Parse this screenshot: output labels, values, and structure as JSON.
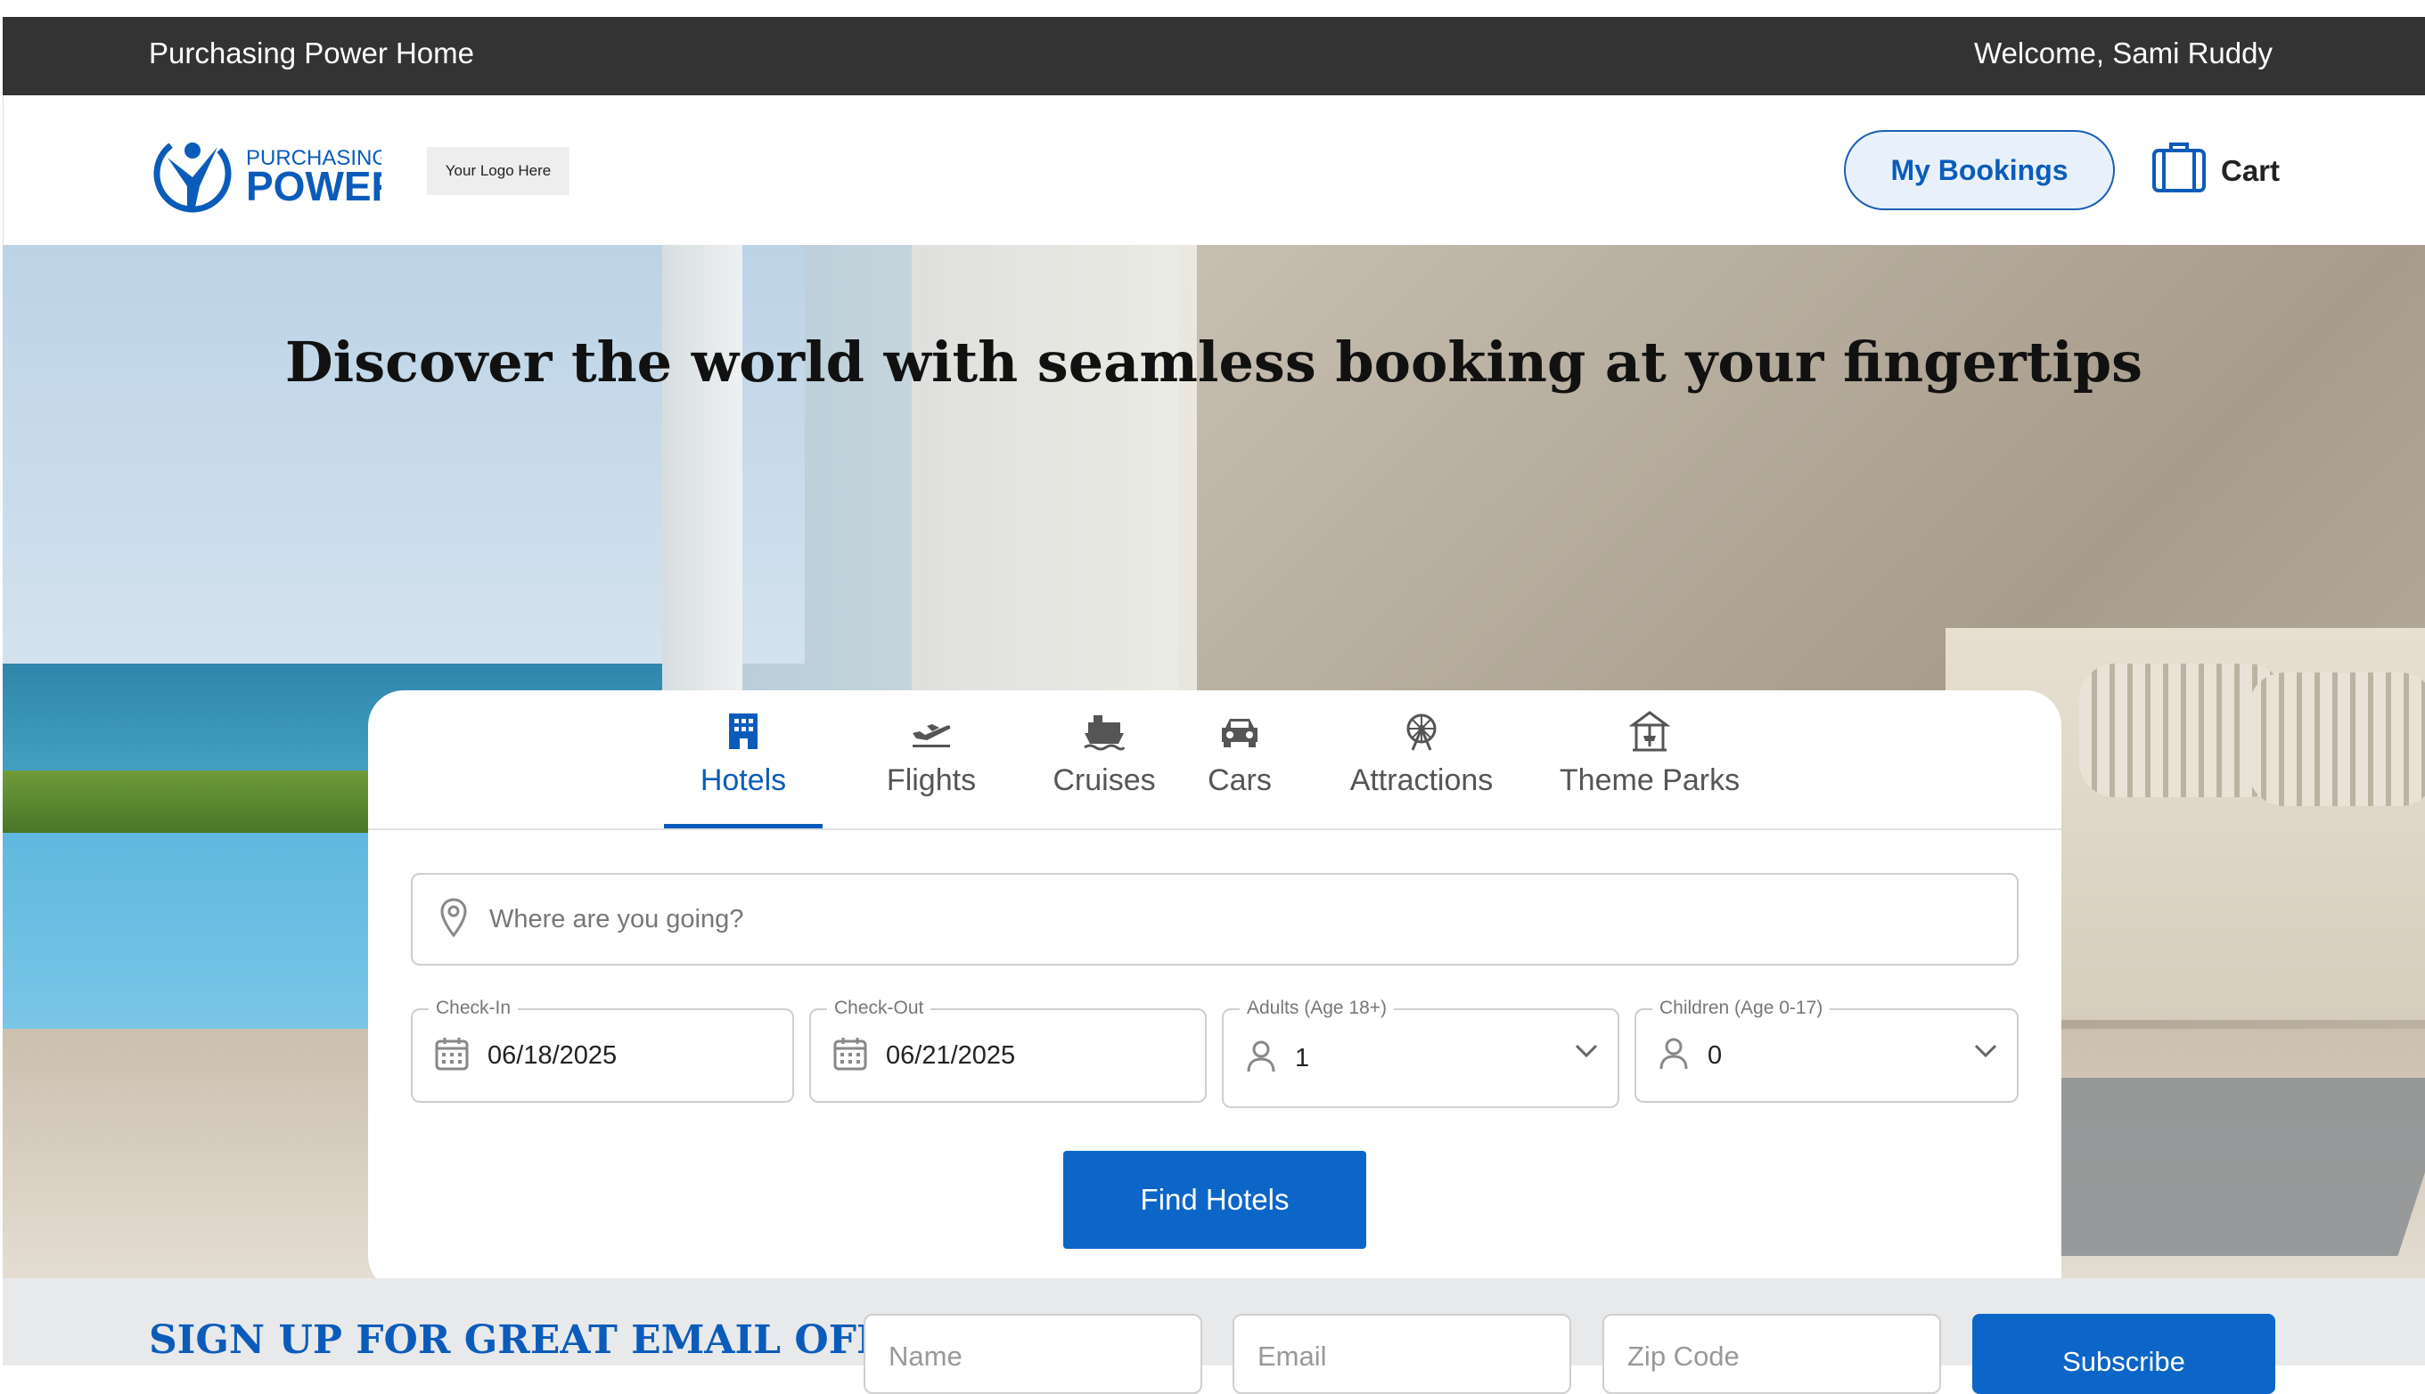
{
  "topbar": {
    "home_link": "Purchasing Power Home",
    "welcome": "Welcome, Sami Ruddy"
  },
  "header": {
    "brand_top": "PURCHASING",
    "brand_bottom": "POWER",
    "logo_placeholder": "Your Logo Here",
    "my_bookings": "My Bookings",
    "cart": "Cart"
  },
  "hero": {
    "title": "Discover the world with seamless booking at your fingertips"
  },
  "tabs": [
    {
      "label": "Hotels",
      "icon": "hotel-icon",
      "active": true
    },
    {
      "label": "Flights",
      "icon": "flight-icon",
      "active": false
    },
    {
      "label": "Cruises",
      "icon": "cruise-ship-icon",
      "active": false
    },
    {
      "label": "Cars",
      "icon": "car-icon",
      "active": false
    },
    {
      "label": "Attractions",
      "icon": "ferris-wheel-icon",
      "active": false
    },
    {
      "label": "Theme Parks",
      "icon": "carousel-icon",
      "active": false
    }
  ],
  "search": {
    "destination_placeholder": "Where are you going?",
    "checkin_label": "Check-In",
    "checkin_value": "06/18/2025",
    "checkout_label": "Check-Out",
    "checkout_value": "06/21/2025",
    "adults_label": "Adults (Age 18+)",
    "adults_value": "1",
    "children_label": "Children (Age 0-17)",
    "children_value": "0",
    "find_button": "Find Hotels"
  },
  "signup": {
    "title": "SIGN UP FOR GREAT EMAIL OFFERS",
    "name_placeholder": "Name",
    "email_placeholder": "Email",
    "zip_placeholder": "Zip Code",
    "subscribe": "Subscribe"
  },
  "colors": {
    "brand_blue": "#0b5cba",
    "topbar_bg": "#333333"
  }
}
